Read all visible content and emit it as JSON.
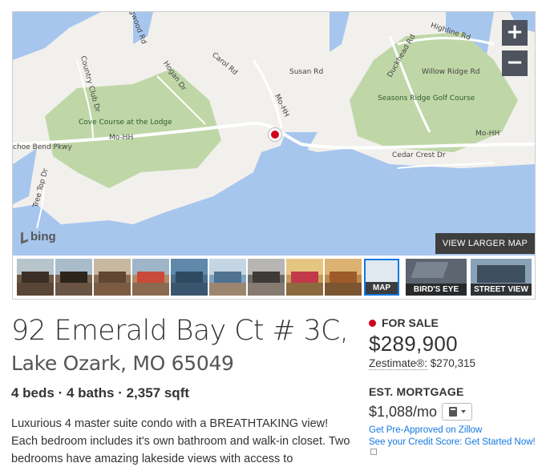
{
  "map": {
    "labels": {
      "dogwood": "Dogwood Rd",
      "highline": "Highline Rd",
      "duckhead": "Duckhead Rd",
      "carol": "Carol Rd",
      "hogan": "Hogan Dr",
      "country_club": "Country Club Dr",
      "susan": "Susan Rd",
      "willow": "Willow Ridge Rd",
      "cove": "Cove Course at the Lodge",
      "seasons": "Seasons Ridge Golf Course",
      "mohh1": "Mo-HH",
      "mohh2": "Mo-HH",
      "mohh3": "Mo-HH",
      "horseshoe": "choe Bend Pkwy",
      "tree_top": "Tree Top Dr",
      "cedar": "Cedar Crest Dr"
    },
    "zoom_in": "+",
    "zoom_out": "−",
    "bing": "bing",
    "view_larger": "VIEW LARGER MAP"
  },
  "thumbnails": {
    "tiles": {
      "map": "MAP",
      "birds_eye": "BIRD'S EYE",
      "street_view": "STREET VIEW"
    }
  },
  "listing": {
    "address_line1": "92 Emerald Bay Ct # 3C,",
    "address_line2": "Lake Ozark, MO 65049",
    "facts": "4 beds · 4 baths · 2,357 sqft",
    "description": "Luxurious 4 master suite condo with a BREATHTAKING view! Each bedroom includes it's own bathroom and walk-in closet. Two bedrooms have amazing lakeside views with access to"
  },
  "pricing": {
    "status": "FOR SALE",
    "price": "$289,900",
    "zestimate_label": "Zestimate®:",
    "zestimate_value": "$270,315",
    "est_mortgage_label": "EST. MORTGAGE",
    "mortgage": "$1,088/mo",
    "preapproved_link": "Get Pre-Approved on Zillow",
    "credit_link": "See your Credit Score: Get Started Now!"
  },
  "colors": {
    "water": "#a7c6ee",
    "land": "#f2f0ec",
    "golf": "#bfd7a7",
    "accent_link": "#1277e1",
    "status_dot": "#d0021b"
  }
}
